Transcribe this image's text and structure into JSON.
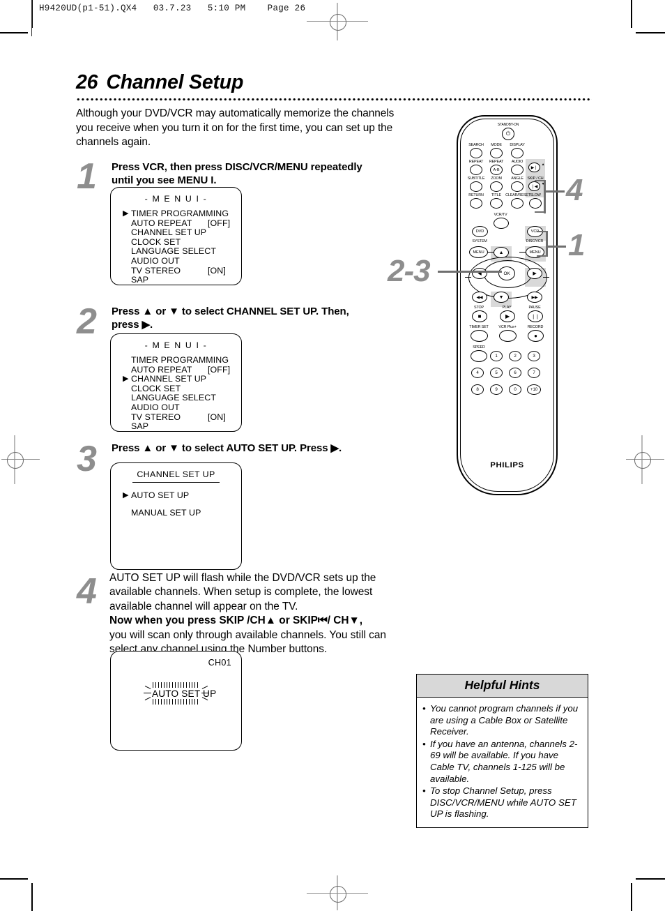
{
  "print_marks": {
    "file_stamp": "H9420UD(p1-51).QX4   03.7.23   5:10 PM    Page 26"
  },
  "header": {
    "page_number": "26",
    "title": "Channel Setup"
  },
  "intro": "Although your DVD/VCR may automatically memorize the channels you receive when you turn it on for the first time, you can set up the channels again.",
  "steps": [
    {
      "num": "1",
      "instruction_lines": [
        "Press VCR, then press DISC/VCR/MENU repeatedly",
        "until you see MENU I."
      ],
      "screen": {
        "title": "- M E N U  I -",
        "rows": [
          {
            "cursor": "▶",
            "label": "TIMER PROGRAMMING",
            "value": ""
          },
          {
            "cursor": "",
            "label": "AUTO REPEAT",
            "value": "[OFF]"
          },
          {
            "cursor": "",
            "label": "CHANNEL SET UP",
            "value": ""
          },
          {
            "cursor": "",
            "label": "CLOCK SET",
            "value": ""
          },
          {
            "cursor": "",
            "label": "LANGUAGE SELECT",
            "value": ""
          },
          {
            "cursor": "",
            "label": "AUDIO OUT",
            "value": ""
          },
          {
            "cursor": "",
            "label": "TV STEREO",
            "value": "[ON]"
          },
          {
            "cursor": "",
            "label": "SAP",
            "value": ""
          }
        ]
      }
    },
    {
      "num": "2",
      "instruction_lines": [
        "Press ▲ or ▼ to select CHANNEL SET UP. Then,",
        "press ▶."
      ],
      "screen": {
        "title": "- M E N U  I -",
        "rows": [
          {
            "cursor": "",
            "label": "TIMER PROGRAMMING",
            "value": ""
          },
          {
            "cursor": "",
            "label": "AUTO REPEAT",
            "value": "[OFF]"
          },
          {
            "cursor": "▶",
            "label": "CHANNEL SET UP",
            "value": ""
          },
          {
            "cursor": "",
            "label": "CLOCK SET",
            "value": ""
          },
          {
            "cursor": "",
            "label": "LANGUAGE SELECT",
            "value": ""
          },
          {
            "cursor": "",
            "label": "AUDIO OUT",
            "value": ""
          },
          {
            "cursor": "",
            "label": "TV STEREO",
            "value": "[ON]"
          },
          {
            "cursor": "",
            "label": "SAP",
            "value": ""
          }
        ]
      }
    },
    {
      "num": "3",
      "instruction_lines": [
        "Press ▲ or ▼ to select AUTO SET UP. Press ▶."
      ],
      "screen": {
        "title": "CHANNEL SET UP",
        "rows": [
          {
            "cursor": "▶",
            "label": "AUTO SET UP",
            "value": ""
          },
          {
            "cursor": "",
            "label": "MANUAL SET UP",
            "value": ""
          }
        ]
      }
    },
    {
      "num": "4",
      "instruction_lines": [
        "AUTO SET UP will flash while the DVD/VCR sets up the",
        "available channels. When setup is complete, the lowest",
        "available channel will appear on the TV.",
        "Now when you press SKIP    /CH▲ or SKIP⏮/ CH▼,",
        "you will scan only through available channels. You still can",
        "select any channel using the Number buttons."
      ],
      "screen": {
        "channel": "CH01",
        "flash_text": "AUTO SET UP"
      }
    }
  ],
  "hints": {
    "title": "Helpful Hints",
    "bullet": "•",
    "items": [
      "You cannot program channels if you are using a Cable Box or Satellite Receiver.",
      "If you have an antenna, channels 2-69 will be available. If you have Cable TV, channels 1-125 will be available.",
      "To stop Channel Setup, press DISC/VCR/MENU while AUTO SET UP is flashing."
    ]
  },
  "remote": {
    "brand": "PHILIPS",
    "standby_label": "STANDBY-ON",
    "standby_glyph": "⏻",
    "labels_row1": [
      "SEARCH",
      "MODE",
      "DISPLAY"
    ],
    "labels_row2": [
      "REPEAT",
      "REPEAT",
      "AUDIO"
    ],
    "labels_row3": [
      "SUBTITLE",
      "ZOOM",
      "ANGLE",
      "SKIP / CH"
    ],
    "labels_row4": [
      "RETURN",
      "TITLE",
      "CLEAR/RESET",
      "SLOW"
    ],
    "ab_button": "A-B",
    "skip_next": "▶❘",
    "skip_prev": "❘◀",
    "skip_up_arrow": "▲",
    "skip_down_arrow": "▼",
    "vcrtv_label": "VCR/TV",
    "dvd_button": "DVD",
    "vcr_button": "VCR",
    "system_label": "SYSTEM",
    "discvcr_label": "DISC/VCR",
    "menu_button_left": "MENU",
    "menu_button_right": "MENU",
    "ok_button": "OK",
    "nav_up": "▲",
    "nav_down": "▼",
    "nav_left": "◀",
    "nav_right": "▶",
    "rew_button": "◀◀",
    "ff_button": "▶▶",
    "stop_label": "STOP",
    "play_label": "PLAY",
    "pause_label": "PAUSE",
    "stop_glyph": "■",
    "play_glyph": "▶",
    "pause_glyph": "❘❘",
    "timerset_label": "TIMER SET",
    "vcrplus_label": "VCR Plus+",
    "record_label": "RECORD",
    "record_glyph": "●",
    "speed_label": "SPEED",
    "numbers": [
      "1",
      "2",
      "3",
      "4",
      "5",
      "6",
      "7",
      "8",
      "9",
      "0",
      "+10"
    ]
  },
  "callouts": [
    {
      "id": "callout-4",
      "label": "4"
    },
    {
      "id": "callout-1",
      "label": "1"
    },
    {
      "id": "callout-2-3",
      "label": "2-3"
    }
  ]
}
